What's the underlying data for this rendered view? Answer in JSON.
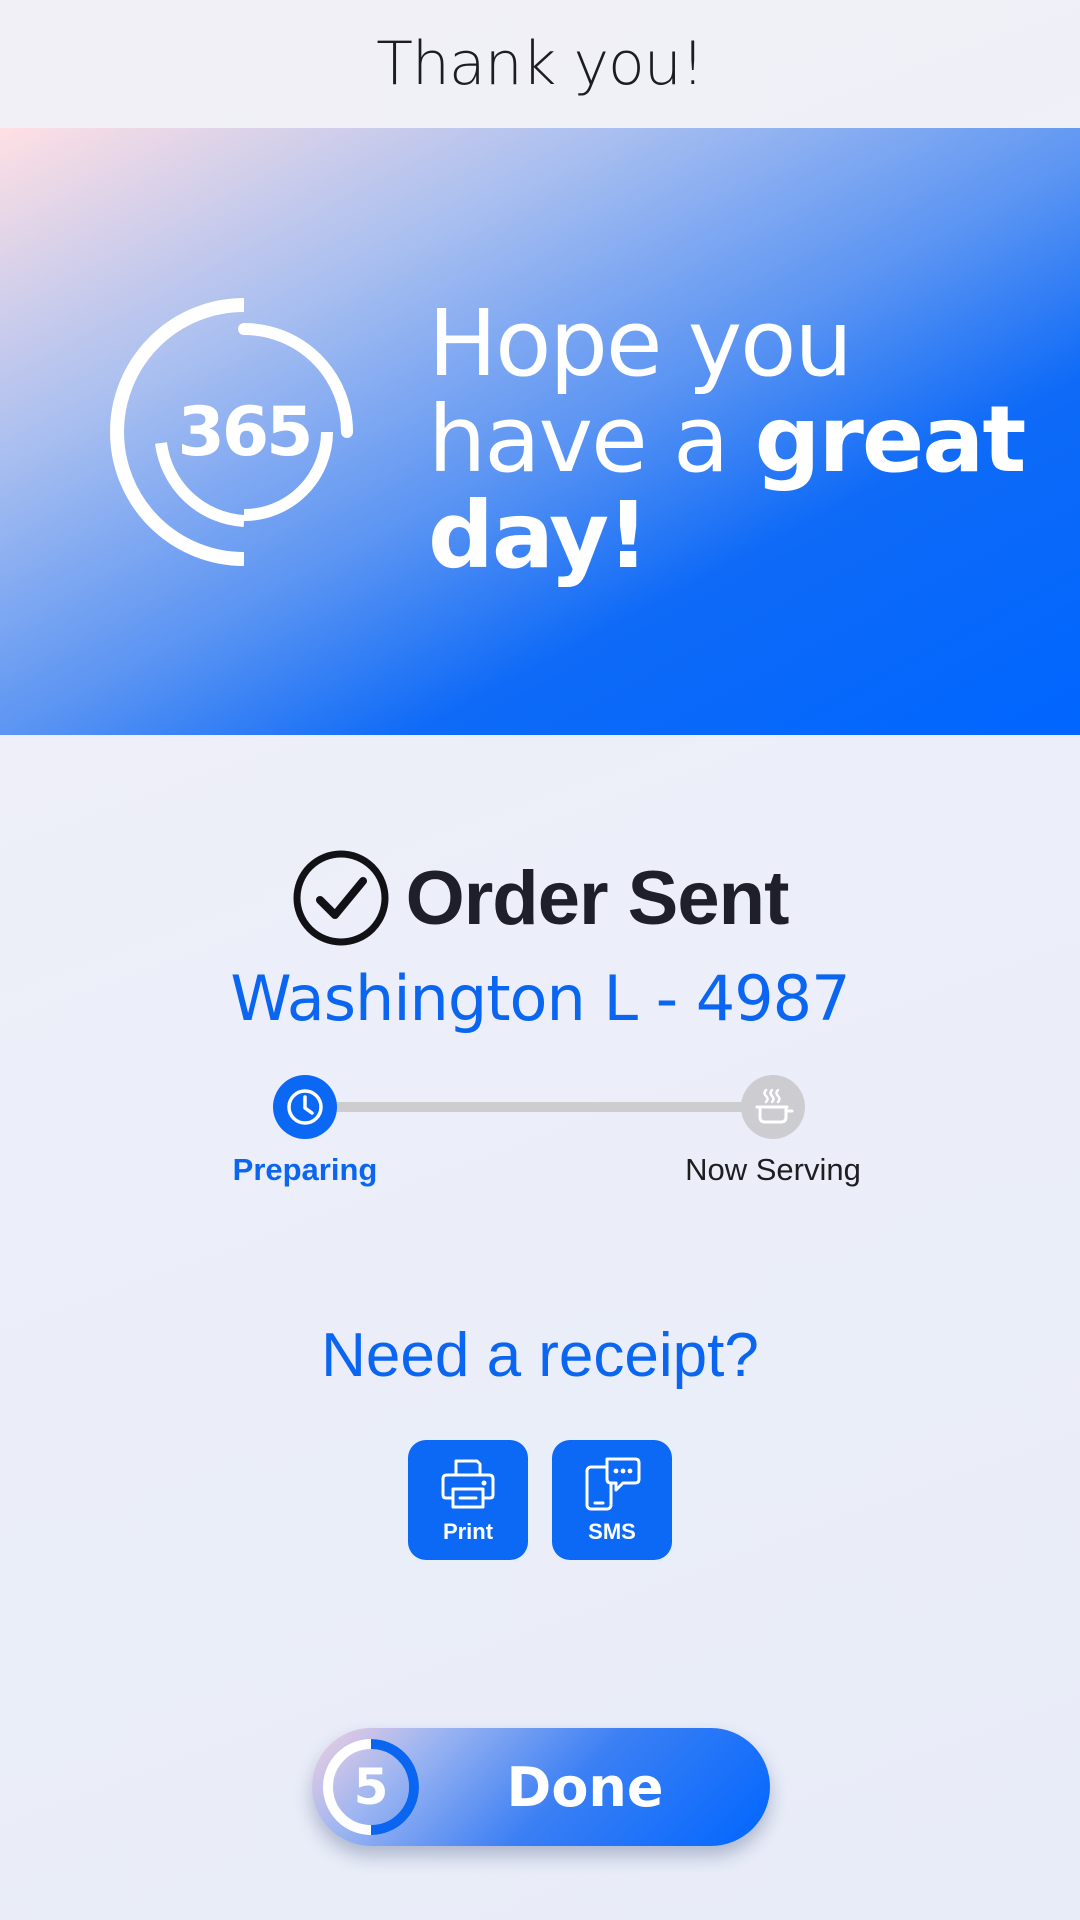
{
  "header": {
    "title": "Thank you!"
  },
  "hero": {
    "logo_text": "365",
    "message_line1": "Hope you",
    "message_line2_light": "have a ",
    "message_line2_bold": "great",
    "message_line3_bold": "day!"
  },
  "order": {
    "status_title": "Order Sent",
    "customer_label": "Washington L - 4987"
  },
  "progress": {
    "steps": [
      {
        "label": "Preparing",
        "icon": "clock-icon",
        "active": true
      },
      {
        "label": "Now Serving",
        "icon": "serving-pot-icon",
        "active": false
      }
    ]
  },
  "receipt": {
    "title": "Need a receipt?",
    "buttons": [
      {
        "label": "Print",
        "icon": "printer-icon"
      },
      {
        "label": "SMS",
        "icon": "phone-message-icon"
      }
    ]
  },
  "done": {
    "label": "Done",
    "countdown": "5"
  },
  "colors": {
    "accent": "#0a66f0",
    "inactive": "#cdcdd0",
    "text_dark": "#1f1f2b"
  }
}
